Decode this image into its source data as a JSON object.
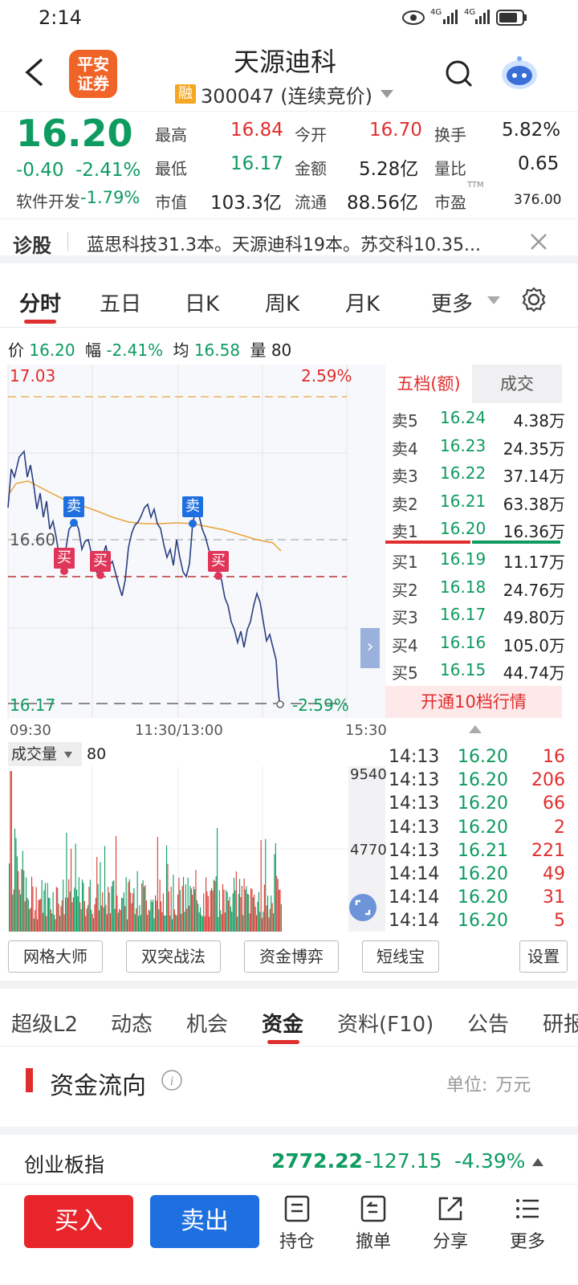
{
  "status": {
    "time": "2:14",
    "net1": "4G",
    "net2": "4G"
  },
  "header": {
    "logo_line1": "平安",
    "logo_line2": "证券",
    "title": "天源迪科",
    "margin_badge": "融",
    "code_text": "300047 (连续竞价)"
  },
  "quote": {
    "price": "16.20",
    "change": "-0.40",
    "change_pct": "-2.41%",
    "sector_name": "软件开发",
    "sector_pct": "-1.79%",
    "items": [
      {
        "k": "最高",
        "v": "16.84"
      },
      {
        "k": "今开",
        "v": "16.70"
      },
      {
        "k": "换手",
        "v": "5.82%"
      },
      {
        "k": "最低",
        "v": "16.17"
      },
      {
        "k": "金额",
        "v": "5.28亿"
      },
      {
        "k": "量比",
        "v": "0.65"
      },
      {
        "k": "市值",
        "v": "103.3亿"
      },
      {
        "k": "流通",
        "v": "88.56亿"
      },
      {
        "k": "市盈",
        "v": "376.00"
      }
    ],
    "ttm": "TTM"
  },
  "diagnose": {
    "label": "诊股",
    "text": "蓝思科技31.3本。天源迪科19本。苏交科10.35..."
  },
  "chart_tabs": [
    "分时",
    "五日",
    "日K",
    "周K",
    "月K",
    "更多"
  ],
  "info_bar": {
    "price_label": "价",
    "price": "16.20",
    "amp_label": "幅",
    "amp": "-2.41%",
    "avg_label": "均",
    "avg": "16.58",
    "vol_label": "量",
    "vol": "80"
  },
  "chart_labels": {
    "top": "17.03",
    "top_pct": "2.59%",
    "mid": "16.60",
    "bottom": "16.17",
    "bottom_pct": "-2.59%",
    "t_start": "09:30",
    "t_mid": "11:30/13:00",
    "t_end": "15:30",
    "buy": "买",
    "sell": "卖"
  },
  "orderbook": {
    "tab_active": "五档(额)",
    "tab_other": "成交",
    "sells": [
      {
        "label": "卖5",
        "price": "16.24",
        "amount": "4.38万"
      },
      {
        "label": "卖4",
        "price": "16.23",
        "amount": "24.35万"
      },
      {
        "label": "卖3",
        "price": "16.22",
        "amount": "37.14万"
      },
      {
        "label": "卖2",
        "price": "16.21",
        "amount": "63.38万"
      },
      {
        "label": "卖1",
        "price": "16.20",
        "amount": "16.36万"
      }
    ],
    "buys": [
      {
        "label": "买1",
        "price": "16.19",
        "amount": "11.17万"
      },
      {
        "label": "买2",
        "price": "16.18",
        "amount": "24.76万"
      },
      {
        "label": "买3",
        "price": "16.17",
        "amount": "49.80万"
      },
      {
        "label": "买4",
        "price": "16.16",
        "amount": "105.0万"
      },
      {
        "label": "买5",
        "price": "16.15",
        "amount": "44.74万"
      }
    ],
    "upgrade_text": "开通10档行情"
  },
  "volume": {
    "label": "成交量",
    "value": "80",
    "max": "9540",
    "mid": "4770"
  },
  "ticks": [
    {
      "time": "14:13",
      "price": "16.20",
      "vol": "16"
    },
    {
      "time": "14:13",
      "price": "16.20",
      "vol": "206"
    },
    {
      "time": "14:13",
      "price": "16.20",
      "vol": "66"
    },
    {
      "time": "14:13",
      "price": "16.20",
      "vol": "2"
    },
    {
      "time": "14:13",
      "price": "16.21",
      "vol": "221"
    },
    {
      "time": "14:14",
      "price": "16.20",
      "vol": "49"
    },
    {
      "time": "14:14",
      "price": "16.20",
      "vol": "31"
    },
    {
      "time": "14:14",
      "price": "16.20",
      "vol": "5"
    }
  ],
  "strategy_buttons": [
    "网格大师",
    "双突战法",
    "资金博弈",
    "短线宝",
    "设置"
  ],
  "sub_tabs": [
    "超级L2",
    "动态",
    "机会",
    "资金",
    "资料(F10)",
    "公告",
    "研报"
  ],
  "fund": {
    "title": "资金流向",
    "unit_label": "单位:",
    "unit": "万元"
  },
  "index": {
    "name": "创业板指",
    "value": "2772.22",
    "change": "-127.15",
    "pct": "-4.39%"
  },
  "bottom": {
    "buy": "买入",
    "sell": "卖出",
    "items": [
      "持仓",
      "撤单",
      "分享",
      "更多"
    ]
  },
  "colors": {
    "up": "#e02e2e",
    "down": "#0e9b5f",
    "accent": "#e02e2e",
    "blue": "#1e6fe0",
    "avg_line": "#e8a33a",
    "price_line": "#2a3f80"
  }
}
